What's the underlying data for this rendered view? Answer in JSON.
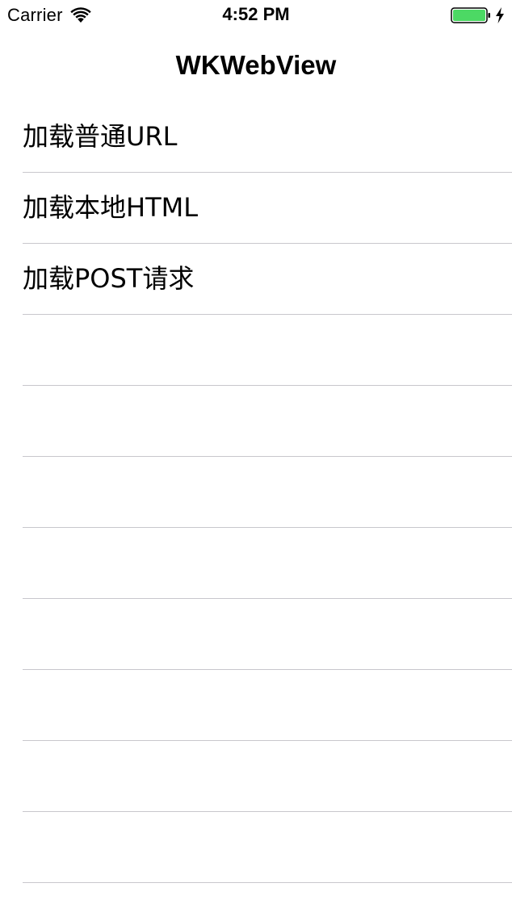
{
  "status_bar": {
    "carrier": "Carrier",
    "time": "4:52 PM",
    "battery_color": "#4cd964"
  },
  "nav": {
    "title": "WKWebView"
  },
  "table": {
    "rows": [
      {
        "label": "加载普通URL"
      },
      {
        "label": "加载本地HTML"
      },
      {
        "label": "加载POST请求"
      },
      {
        "label": ""
      },
      {
        "label": ""
      },
      {
        "label": ""
      },
      {
        "label": ""
      },
      {
        "label": ""
      },
      {
        "label": ""
      },
      {
        "label": ""
      },
      {
        "label": ""
      }
    ]
  }
}
